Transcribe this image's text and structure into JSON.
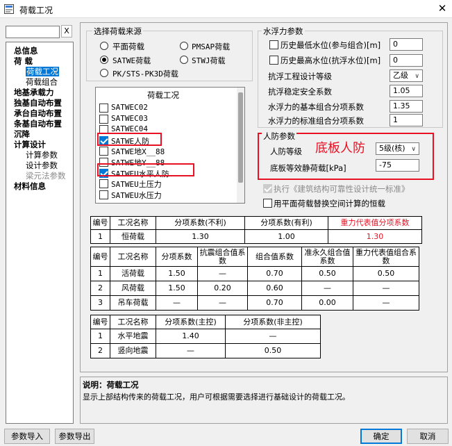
{
  "window": {
    "title": "荷载工况"
  },
  "search": {
    "value": "",
    "clear_label": "X"
  },
  "tree": [
    {
      "label": "总信息",
      "bold": true,
      "level": 0
    },
    {
      "label": "荷  载",
      "bold": true,
      "level": 0
    },
    {
      "label": "荷载工况",
      "bold": false,
      "level": 1,
      "selected": true
    },
    {
      "label": "荷载组合",
      "bold": false,
      "level": 1
    },
    {
      "label": "地基承载力",
      "bold": true,
      "level": 0
    },
    {
      "label": "独基自动布置",
      "bold": true,
      "level": 0
    },
    {
      "label": "承台自动布置",
      "bold": true,
      "level": 0
    },
    {
      "label": "条基自动布置",
      "bold": true,
      "level": 0
    },
    {
      "label": "沉降",
      "bold": true,
      "level": 0
    },
    {
      "label": "计算设计",
      "bold": true,
      "level": 0
    },
    {
      "label": "计算参数",
      "bold": false,
      "level": 1
    },
    {
      "label": "设计参数",
      "bold": false,
      "level": 1
    },
    {
      "label": "梁元法参数",
      "bold": false,
      "level": 1,
      "disabled": true
    },
    {
      "label": "材料信息",
      "bold": true,
      "level": 0
    }
  ],
  "load_source": {
    "legend": "选择荷载来源",
    "options": [
      {
        "label": "平面荷载",
        "checked": false
      },
      {
        "label": "PMSAP荷载",
        "checked": false
      },
      {
        "label": "SATWE荷载",
        "checked": true
      },
      {
        "label": "STWJ荷载",
        "checked": false
      },
      {
        "label": "PK/STS-PK3D荷载",
        "checked": false
      }
    ]
  },
  "load_cases": {
    "header": "荷载工况",
    "items": [
      {
        "label": "SATWEC02",
        "checked": false
      },
      {
        "label": "SATWEC03",
        "checked": false
      },
      {
        "label": "SATWEC04",
        "checked": false
      },
      {
        "label": "SATWE人防",
        "checked": true
      },
      {
        "label": "SATWE地X__88",
        "checked": false
      },
      {
        "label": "SATWE地Y__88",
        "checked": false
      },
      {
        "label": "SATWEU水平人防",
        "checked": true
      },
      {
        "label": "SATWEU土压力",
        "checked": false
      },
      {
        "label": "SATWEU水压力",
        "checked": false
      }
    ]
  },
  "buoyancy": {
    "legend": "水浮力参数",
    "hist_min": {
      "label": "历史最低水位(参与组合)[m]",
      "checked": false,
      "value": "0"
    },
    "hist_max": {
      "label": "历史最高水位(抗浮水位)[m]",
      "checked": false,
      "value": "0"
    },
    "grade": {
      "label": "抗浮工程设计等级",
      "value": "乙级"
    },
    "safety": {
      "label": "抗浮稳定安全系数",
      "value": "1.05"
    },
    "basic": {
      "label": "水浮力的基本组合分项系数",
      "value": "1.35"
    },
    "standard": {
      "label": "水浮力的标准组合分项系数",
      "value": "1"
    }
  },
  "civil_defense": {
    "legend": "人防参数",
    "grade": {
      "label": "人防等级",
      "value": "5级(核)"
    },
    "equiv_load": {
      "label": "底板等效静荷载[kPa]",
      "value": "-75"
    },
    "annotation": "底板人防"
  },
  "options": {
    "execute": {
      "label": "执行《建筑结构可靠性设计统一标准》",
      "checked": true,
      "disabled": true
    },
    "plane_replace": {
      "label": "用平面荷载替换空间计算的恒载",
      "checked": false
    }
  },
  "table1": {
    "headers": [
      "编号",
      "工况名称",
      "分项系数(不利)",
      "分项系数(有利)",
      "重力代表值分项系数"
    ],
    "rows": [
      [
        "1",
        "恒荷载",
        "1.30",
        "1.00",
        "1.30"
      ]
    ]
  },
  "table2": {
    "headers": [
      "编号",
      "工况名称",
      "分项系数",
      "抗震组合值系数",
      "组合值系数",
      "准永久组合值系数",
      "重力代表值组合系数"
    ],
    "rows": [
      [
        "1",
        "活荷载",
        "1.50",
        "—",
        "0.70",
        "0.50",
        "0.50"
      ],
      [
        "2",
        "风荷载",
        "1.50",
        "0.20",
        "0.60",
        "—",
        "—"
      ],
      [
        "3",
        "吊车荷载",
        "—",
        "—",
        "0.70",
        "0.00",
        "—"
      ]
    ]
  },
  "table3": {
    "headers": [
      "编号",
      "工况名称",
      "分项系数(主控)",
      "分项系数(非主控)"
    ],
    "rows": [
      [
        "1",
        "水平地震",
        "1.40",
        "—"
      ],
      [
        "2",
        "竖向地震",
        "—",
        "0.50"
      ]
    ]
  },
  "description": {
    "title": "说明：荷载工况",
    "text": "显示上部结构传来的荷载工况，用户可根据需要选择进行基础设计的荷载工况。"
  },
  "buttons": {
    "import": "参数导入",
    "export": "参数导出",
    "ok": "确定",
    "cancel": "取消"
  },
  "colors": {
    "accent": "#0078d7",
    "annotation_red": "#e81123"
  }
}
